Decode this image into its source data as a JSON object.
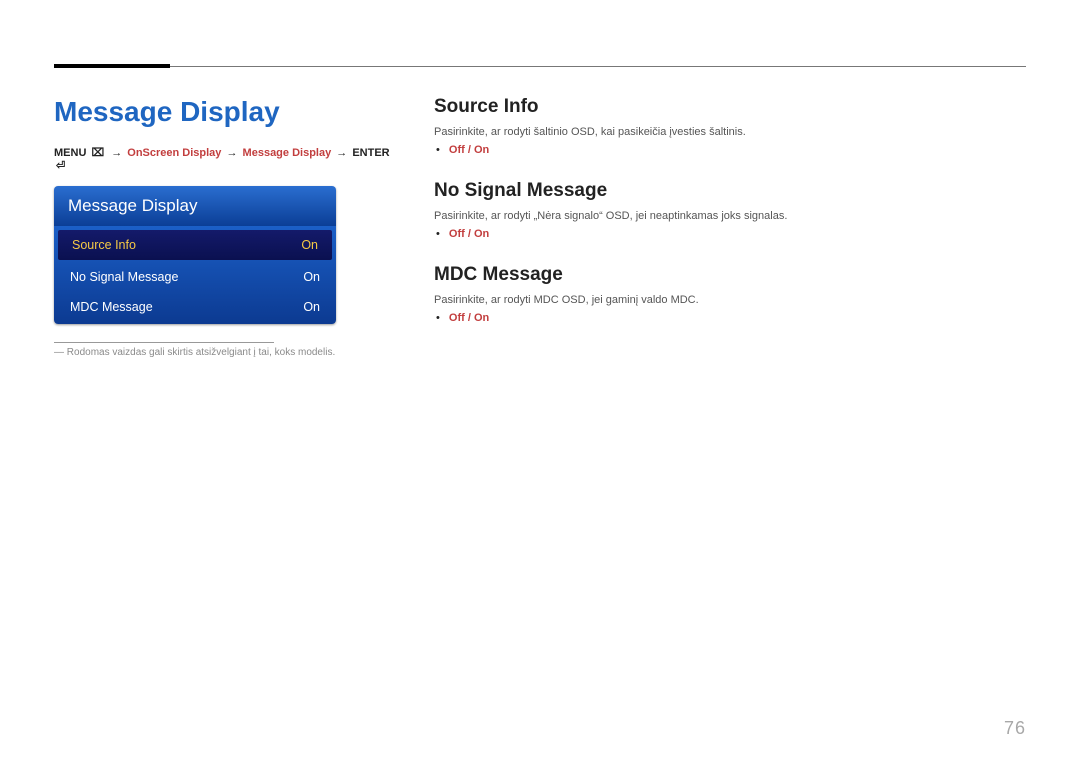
{
  "pageNumber": "76",
  "left": {
    "title": "Message Display",
    "breadcrumb": {
      "menuLabel": "MENU",
      "menuIcon": "⌧",
      "arrow": "→",
      "seg1": "OnScreen Display",
      "seg2": "Message Display",
      "enterLabel": "ENTER",
      "enterIcon": "⏎"
    },
    "osd": {
      "title": "Message Display",
      "rows": [
        {
          "label": "Source Info",
          "value": "On",
          "selected": true
        },
        {
          "label": "No Signal Message",
          "value": "On",
          "selected": false
        },
        {
          "label": "MDC Message",
          "value": "On",
          "selected": false
        }
      ]
    },
    "footnote": "Rodomas vaizdas gali skirtis atsižvelgiant į tai, koks modelis."
  },
  "right": {
    "sections": [
      {
        "heading": "Source Info",
        "desc": "Pasirinkite, ar rodyti šaltinio OSD, kai pasikeičia įvesties šaltinis.",
        "options": "Off / On"
      },
      {
        "heading": "No Signal Message",
        "desc": "Pasirinkite, ar rodyti „Nėra signalo“ OSD, jei neaptinkamas joks signalas.",
        "options": "Off / On"
      },
      {
        "heading": "MDC Message",
        "desc": "Pasirinkite, ar rodyti MDC OSD, jei gaminį valdo MDC.",
        "options": "Off / On"
      }
    ]
  }
}
